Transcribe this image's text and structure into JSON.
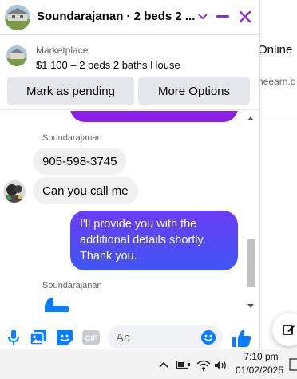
{
  "background": {
    "online_label": "Online",
    "url_fragment": "neearn.c"
  },
  "header": {
    "title": "Soundarajanan · 2 beds 2 ..."
  },
  "listing": {
    "source": "Marketplace",
    "price_line": "$1,100 – 2 beds 2 baths House",
    "mark_pending_label": "Mark as pending",
    "more_options_label": "More Options"
  },
  "messages": {
    "sender_name_1": "Soundarajanan",
    "msg_phone": "905-598-3745",
    "msg_call": "Can you call me",
    "msg_outgoing": "I'll provide you with the additional details shortly. Thank you.",
    "sender_name_2": "Soundarajanan"
  },
  "composer": {
    "placeholder": "Aa",
    "icons": [
      "microphone-icon",
      "photo-icon",
      "sticker-icon",
      "gif-icon",
      "emoji-icon",
      "like-icon"
    ]
  },
  "taskbar": {
    "time": "7:10 pm",
    "date": "01/02/2025"
  },
  "colors": {
    "accent": "#8a2be2",
    "outgoing_top": "#6b3cf6",
    "outgoing_bottom": "#3f56f2",
    "like_blue": "#0a7cff"
  }
}
